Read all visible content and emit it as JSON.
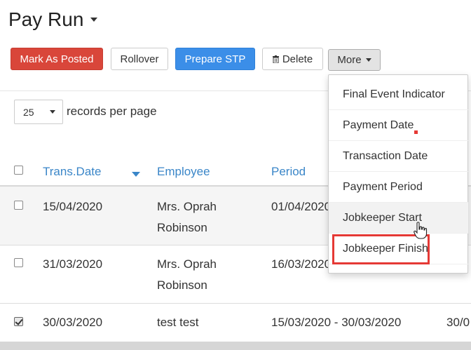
{
  "header": {
    "title": "Pay Run"
  },
  "toolbar": {
    "mark_posted": "Mark As Posted",
    "rollover": "Rollover",
    "prepare_stp": "Prepare STP",
    "delete": "Delete",
    "more": "More"
  },
  "pagination": {
    "per_page_value": "25",
    "per_page_label": "records per page"
  },
  "table": {
    "columns": [
      "Trans.Date",
      "Employee",
      "Period"
    ],
    "rows": [
      {
        "trans_date": "15/04/2020",
        "employee_line1": "Mrs. Oprah",
        "employee_line2": "Robinson",
        "period": "01/04/2020",
        "checked": false
      },
      {
        "trans_date": "31/03/2020",
        "employee_line1": "Mrs. Oprah",
        "employee_line2": "Robinson",
        "period": "16/03/2020",
        "checked": false
      },
      {
        "trans_date": "30/03/2020",
        "employee_line1": "test test",
        "employee_line2": "",
        "period": "15/03/2020 - 30/03/2020",
        "extra": "30/0",
        "checked": true
      }
    ]
  },
  "more_menu": {
    "items": [
      "Final Event Indicator",
      "Payment Date",
      "Transaction Date",
      "Payment Period",
      "Jobkeeper Start",
      "Jobkeeper Finish"
    ]
  },
  "colors": {
    "danger": "#d9463a",
    "primary": "#3b8ee8",
    "link": "#3a86c8",
    "highlight": "#e53935"
  }
}
